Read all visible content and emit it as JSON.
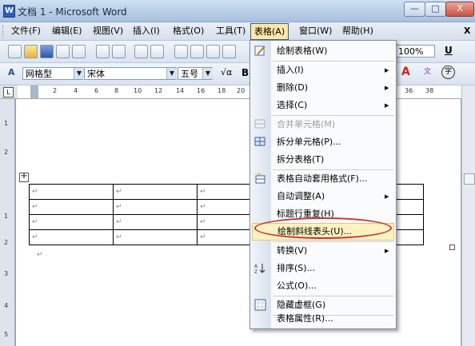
{
  "window": {
    "title": "文档 1 - Microsoft Word",
    "app_icon": "W",
    "min": "—",
    "max": "□",
    "close": "X"
  },
  "menubar": {
    "items": [
      "文件(F)",
      "编辑(E)",
      "视图(V)",
      "插入(I)",
      "格式(O)",
      "工具(T)",
      "表格(A)",
      "窗口(W)",
      "帮助(H)"
    ],
    "close_doc": "X"
  },
  "toolbar2": {
    "style": "网格型",
    "font": "宋体",
    "size": "五号",
    "zoom": "100%",
    "bold": "B",
    "underline": "U"
  },
  "ruler": {
    "numbers": [
      "2",
      "4",
      "6",
      "8",
      "10",
      "12",
      "14",
      "16",
      "18",
      "20",
      "36",
      "38"
    ],
    "corner": "L"
  },
  "left_ruler": {
    "numbers": [
      "1",
      "2",
      "1",
      "2",
      "3",
      "4",
      "5"
    ]
  },
  "table_menu": {
    "items": [
      {
        "label": "绘制表格(W)",
        "icon": "pencil-icon"
      },
      {
        "label": "插入(I)",
        "submenu": true
      },
      {
        "label": "删除(D)",
        "submenu": true
      },
      {
        "label": "选择(C)",
        "submenu": true
      },
      {
        "label": "合并单元格(M)",
        "disabled": true,
        "icon": "merge-cells-icon"
      },
      {
        "label": "拆分单元格(P)...",
        "icon": "split-cells-icon"
      },
      {
        "label": "拆分表格(T)"
      },
      {
        "label": "表格自动套用格式(F)...",
        "icon": "autoformat-icon"
      },
      {
        "label": "自动调整(A)",
        "submenu": true
      },
      {
        "label": "标题行重复(H)"
      },
      {
        "label": "绘制斜线表头(U)...",
        "highlighted": true
      },
      {
        "label": "转换(V)",
        "submenu": true
      },
      {
        "label": "排序(S)...",
        "icon": "sort-az-icon"
      },
      {
        "label": "公式(O)..."
      },
      {
        "label": "隐藏虚框(G)",
        "icon": "gridlines-icon"
      },
      {
        "label": "表格属性(R)..."
      }
    ]
  },
  "table_cell_mark": "↵",
  "colors": {
    "highlight": "#c8323e",
    "menu_hover": "#ffe7a8",
    "title_gradient": "#b7cde6"
  }
}
